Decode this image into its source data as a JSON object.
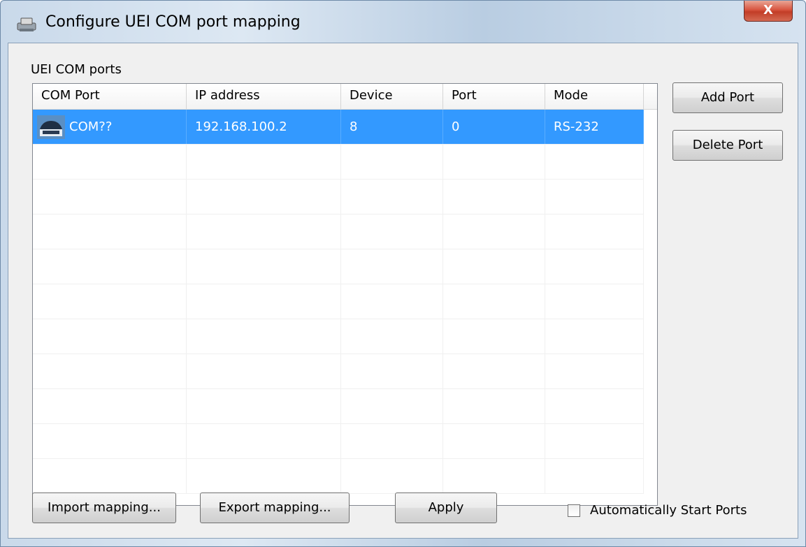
{
  "window": {
    "title": "Configure UEI COM port mapping",
    "close_label": "X"
  },
  "group": {
    "label": "UEI COM ports"
  },
  "table": {
    "columns": [
      "COM Port",
      "IP address",
      "Device",
      "Port",
      "Mode"
    ],
    "rows": [
      {
        "com_port": "COM??",
        "ip_address": "192.168.100.2",
        "device": "8",
        "port": "0",
        "mode": "RS-232",
        "selected": true
      }
    ]
  },
  "buttons": {
    "add_port": "Add Port",
    "delete_port": "Delete Port",
    "import_mapping": "Import mapping...",
    "export_mapping": "Export mapping...",
    "apply": "Apply"
  },
  "options": {
    "auto_start_label": "Automatically Start Ports",
    "auto_start_checked": false
  },
  "colors": {
    "selection": "#3399ff",
    "close_button": "#c94a35"
  }
}
